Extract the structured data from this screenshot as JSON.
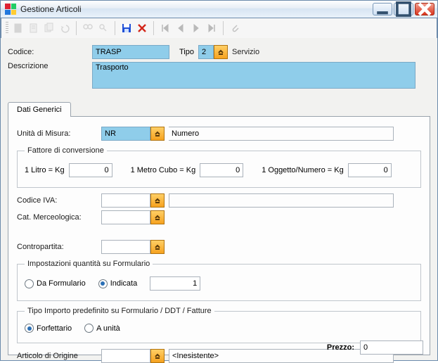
{
  "window": {
    "title": "Gestione Articoli"
  },
  "header": {
    "codice_label": "Codice:",
    "codice_value": "TRASP",
    "tipo_label": "Tipo",
    "tipo_value": "2",
    "tipo_text": "Servizio",
    "descrizione_label": "Descrizione",
    "descrizione_value": "Trasporto"
  },
  "tabs": {
    "generici": "Dati Generici"
  },
  "panel": {
    "um_label": "Unità di Misura:",
    "um_value": "NR",
    "um_text": "Numero",
    "fattore_legend": "Fattore di conversione",
    "litro_label": "1 Litro = Kg",
    "litro_value": "0",
    "cubo_label": "1 Metro Cubo = Kg",
    "cubo_value": "0",
    "oggetto_label": "1 Oggetto/Numero = Kg",
    "oggetto_value": "0",
    "iva_label": "Codice IVA:",
    "iva_value": "",
    "iva_text": "",
    "merc_label": "Cat. Merceologica:",
    "merc_value": "",
    "contro_label": "Contropartita:",
    "contro_value": "",
    "qty_legend": "Impostazioni quantità su Formulario",
    "qty_opt1": "Da Formulario",
    "qty_opt2": "Indicata",
    "qty_value": "1",
    "tipo_legend": "Tipo Importo predefinito su Formulario / DDT / Fatture",
    "tipo_opt1": "Forfettario",
    "tipo_opt2": "A unità",
    "origine_label": "Articolo di Origine",
    "origine_value": "",
    "origine_text": "<Inesistente>",
    "prezzo_label": "Prezzo:",
    "prezzo_value": "0"
  }
}
